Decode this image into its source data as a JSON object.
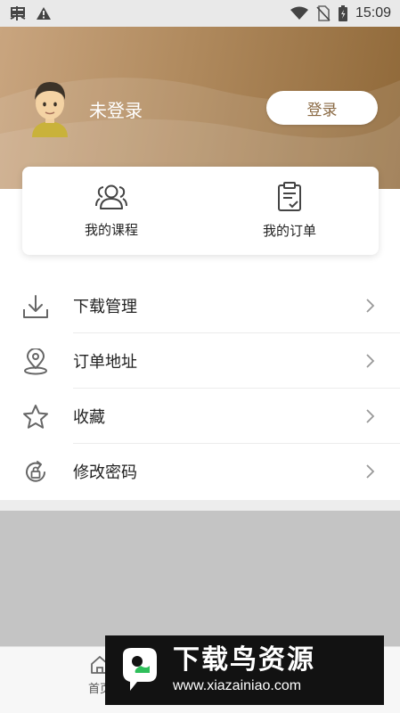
{
  "status_bar": {
    "time": "15:09",
    "icons": [
      "bug-icon",
      "warning-icon",
      "wifi-icon",
      "no-sim-icon",
      "battery-icon"
    ]
  },
  "profile": {
    "name": "未登录",
    "login_label": "登录"
  },
  "quick_links": [
    {
      "label": "我的课程",
      "icon": "people-icon"
    },
    {
      "label": "我的订单",
      "icon": "order-icon"
    }
  ],
  "menu": [
    {
      "label": "下载管理",
      "icon": "download-icon"
    },
    {
      "label": "订单地址",
      "icon": "location-pin-icon"
    },
    {
      "label": "收藏",
      "icon": "star-icon"
    },
    {
      "label": "修改密码",
      "icon": "lock-reset-icon"
    }
  ],
  "bottom_nav": {
    "home_label": "首页"
  },
  "watermark": {
    "title": "下载鸟资源",
    "url": "www.xiazainiao.com"
  },
  "colors": {
    "header_brown": "#a67c4e",
    "status_bar": "#e9e9e9",
    "gray_area": "#c4c4c4"
  }
}
